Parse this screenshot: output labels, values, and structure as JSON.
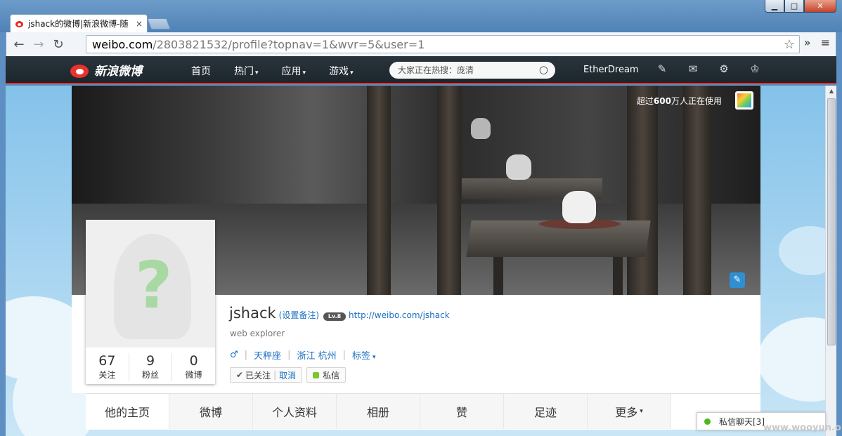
{
  "browser": {
    "tab_title": "jshack的微博|新浪微博-随",
    "tab_close": "×",
    "url_host": "weibo.com",
    "url_path": "/2803821532/profile?topnav=1&wvr=5&user=1",
    "back_glyph": "←",
    "forward_glyph": "→",
    "reload_glyph": "↻",
    "star_glyph": "☆",
    "overflow_glyph": "»",
    "menu_glyph": "≡",
    "win_min": "▁",
    "win_max": "□",
    "win_close": "✕"
  },
  "weibo_nav": {
    "logo_text": "新浪微博",
    "links": [
      "首页",
      "热门",
      "应用",
      "游戏"
    ],
    "search_placeholder": "大家正在热搜：庞清",
    "search_glyph": "○",
    "username": "EtherDream",
    "icons": [
      "edit-icon",
      "mail-icon",
      "gear-icon",
      "crown-icon"
    ],
    "icon_glyphs": [
      "✎",
      "✉",
      "⚙",
      "♔"
    ],
    "caret": "▾"
  },
  "cover": {
    "badge_prefix": "超过",
    "badge_count": "600",
    "badge_suffix": "万人正在使用",
    "edit_glyph": "✎"
  },
  "profile": {
    "avatar_glyph": "?",
    "stats": [
      {
        "num": "67",
        "label": "关注"
      },
      {
        "num": "9",
        "label": "粉丝"
      },
      {
        "num": "0",
        "label": "微博"
      }
    ],
    "name": "jshack",
    "remark": "(设置备注)",
    "level": "Lv.8",
    "link": "http://weibo.com/jshack",
    "bio": "web explorer",
    "gender_glyph": "♂",
    "zodiac": "天秤座",
    "location": "浙江 杭州",
    "tags": "标签",
    "followed_label": "已关注",
    "cancel_label": "取消",
    "message_label": "私信",
    "check_glyph": "✔",
    "separator": "|"
  },
  "profile_tabs": [
    "他的主页",
    "微博",
    "个人资料",
    "相册",
    "赞",
    "足迹",
    "更多"
  ],
  "chat": {
    "label": "私信聊天[3]"
  },
  "watermark": "www.wooyun.org",
  "colors": {
    "accent_red": "#e8322d",
    "link_blue": "#1a6ec0",
    "online_green": "#4cb81f"
  }
}
